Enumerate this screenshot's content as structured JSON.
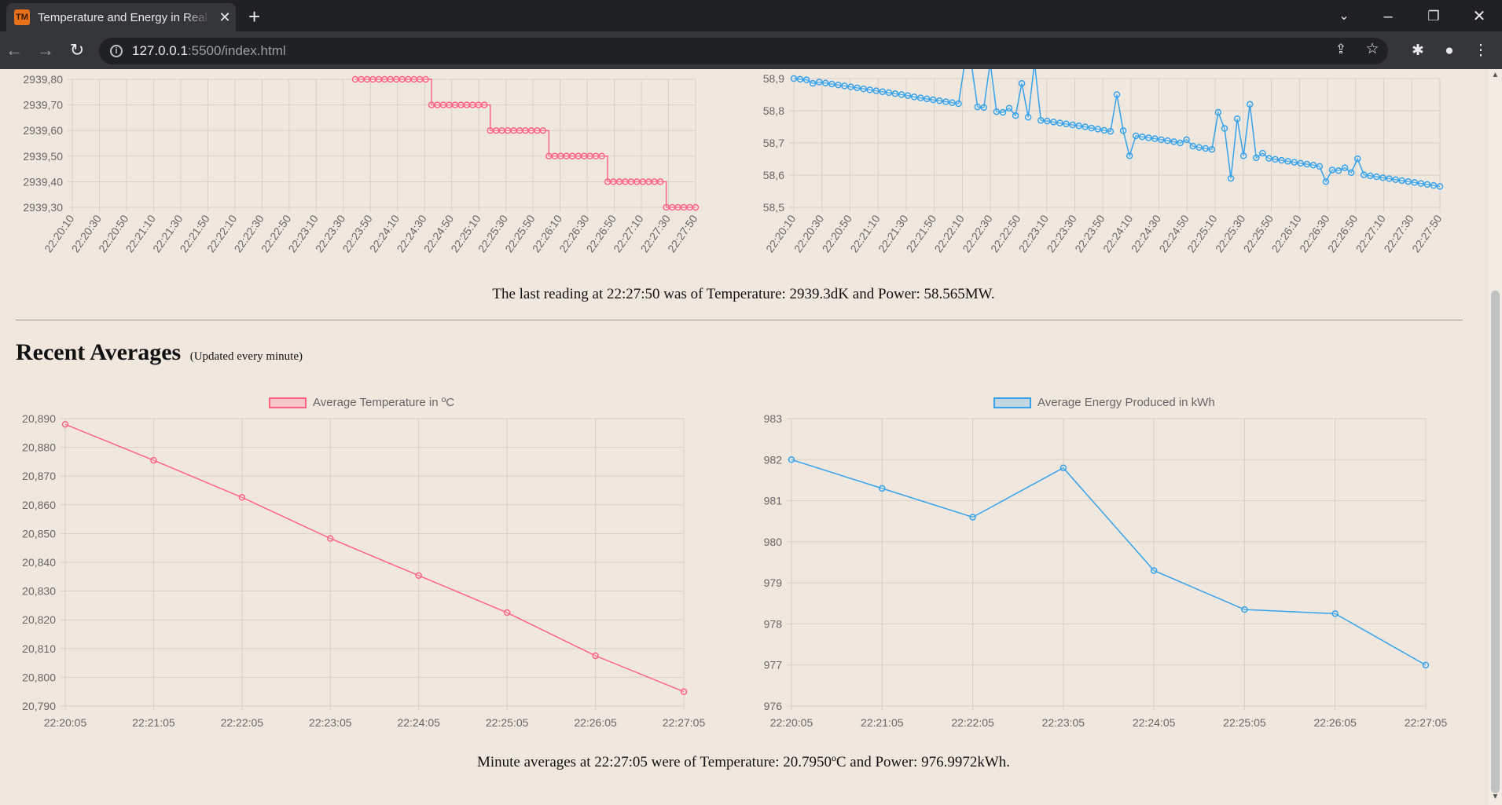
{
  "browser": {
    "tab_title": "Temperature and Energy in Real Time",
    "favicon_text": "TM",
    "url_host": "127.0.0.1",
    "url_rest": ":5500/index.html"
  },
  "live": {
    "caption": "The last reading at 22:27:50 was of Temperature: 2939.3dK and Power: 58.565MW."
  },
  "averages": {
    "heading": "Recent Averages",
    "subheading": "(Updated every minute)",
    "caption": "Minute averages at 22:27:05 were of Temperature: 20.7950ºC and Power: 976.9972kWh."
  },
  "colors": {
    "temperature": "#ff6384",
    "temperature_fill": "rgba(255,99,132,0.25)",
    "energy": "#36a2eb",
    "energy_fill": "rgba(54,162,235,0.25)"
  },
  "chart_data": [
    {
      "id": "live-temperature",
      "type": "line",
      "step": true,
      "color": "#ff6384",
      "x_ticks": [
        "22:20:10",
        "22:20:30",
        "22:20:50",
        "22:21:10",
        "22:21:30",
        "22:21:50",
        "22:22:10",
        "22:22:30",
        "22:22:50",
        "22:23:10",
        "22:23:30",
        "22:23:50",
        "22:24:10",
        "22:24:30",
        "22:24:50",
        "22:25:10",
        "22:25:30",
        "22:25:50",
        "22:26:10",
        "22:26:30",
        "22:26:50",
        "22:27:10",
        "22:27:30",
        "22:27:50"
      ],
      "y_ticks": [
        "2939,80",
        "2939,70",
        "2939,60",
        "2939,50",
        "2939,40",
        "2939,30"
      ],
      "ylim": [
        2939.3,
        2939.8
      ],
      "series": [
        {
          "values": [
            2939.8,
            2939.8,
            2939.8,
            2939.8,
            2939.8,
            2939.8,
            2939.8,
            2939.8,
            2939.8,
            2939.8,
            2939.8,
            2939.8,
            2939.8,
            2939.7,
            2939.7,
            2939.7,
            2939.7,
            2939.7,
            2939.7,
            2939.7,
            2939.7,
            2939.7,
            2939.7,
            2939.6,
            2939.6,
            2939.6,
            2939.6,
            2939.6,
            2939.6,
            2939.6,
            2939.6,
            2939.6,
            2939.6,
            2939.5,
            2939.5,
            2939.5,
            2939.5,
            2939.5,
            2939.5,
            2939.5,
            2939.5,
            2939.5,
            2939.5,
            2939.4,
            2939.4,
            2939.4,
            2939.4,
            2939.4,
            2939.4,
            2939.4,
            2939.4,
            2939.4,
            2939.4,
            2939.3,
            2939.3,
            2939.3,
            2939.3,
            2939.3,
            2939.3
          ],
          "first_tick_offset": 11
        }
      ]
    },
    {
      "id": "live-power",
      "type": "line",
      "color": "#36a2eb",
      "x_ticks": [
        "22:20:10",
        "22:20:30",
        "22:20:50",
        "22:21:10",
        "22:21:30",
        "22:21:50",
        "22:22:10",
        "22:22:30",
        "22:22:50",
        "22:23:10",
        "22:23:30",
        "22:23:50",
        "22:24:10",
        "22:24:30",
        "22:24:50",
        "22:25:10",
        "22:25:30",
        "22:25:50",
        "22:26:10",
        "22:26:30",
        "22:26:50",
        "22:27:10",
        "22:27:30",
        "22:27:50"
      ],
      "y_ticks": [
        "58,9",
        "58,8",
        "58,7",
        "58,6",
        "58,5"
      ],
      "ylim": [
        58.5,
        58.9
      ],
      "series": [
        {
          "values": [
            58.9,
            58.898,
            58.896,
            58.885,
            58.889,
            58.886,
            58.883,
            58.88,
            58.877,
            58.874,
            58.871,
            58.868,
            58.865,
            58.862,
            58.859,
            58.856,
            58.853,
            58.85,
            58.847,
            58.843,
            58.84,
            58.837,
            58.834,
            58.831,
            58.828,
            58.825,
            58.822,
            58.95,
            58.95,
            58.812,
            58.81,
            58.95,
            58.797,
            58.795,
            58.808,
            58.785,
            58.885,
            58.78,
            58.95,
            58.77,
            58.768,
            58.765,
            58.762,
            58.759,
            58.756,
            58.753,
            58.75,
            58.746,
            58.743,
            58.739,
            58.736,
            58.85,
            58.738,
            58.66,
            58.722,
            58.719,
            58.716,
            58.713,
            58.71,
            58.707,
            58.704,
            58.7,
            58.71,
            58.69,
            58.686,
            58.683,
            58.68,
            58.795,
            58.745,
            58.59,
            58.775,
            58.66,
            58.82,
            58.654,
            58.668,
            58.652,
            58.649,
            58.646,
            58.643,
            58.64,
            58.637,
            58.634,
            58.631,
            58.627,
            58.58,
            58.616,
            58.614,
            58.623,
            58.608,
            58.651,
            58.601,
            58.598,
            58.595,
            58.592,
            58.589,
            58.586,
            58.583,
            58.58,
            58.577,
            58.574,
            58.571,
            58.568,
            58.565
          ]
        }
      ]
    },
    {
      "id": "avg-temperature",
      "type": "line",
      "color": "#ff6384",
      "legend": "Average Temperature in ºC",
      "categories": [
        "22:20:05",
        "22:21:05",
        "22:22:05",
        "22:23:05",
        "22:24:05",
        "22:25:05",
        "22:26:05",
        "22:27:05"
      ],
      "y_ticks": [
        "20,890",
        "20,880",
        "20,870",
        "20,860",
        "20,850",
        "20,840",
        "20,830",
        "20,820",
        "20,810",
        "20,800",
        "20,790"
      ],
      "ylim": [
        20.79,
        20.89
      ],
      "series": [
        {
          "name": "Average Temperature in ºC",
          "values": [
            20.888,
            20.8755,
            20.8626,
            20.8483,
            20.8354,
            20.8225,
            20.8075,
            20.795
          ]
        }
      ]
    },
    {
      "id": "avg-energy",
      "type": "line",
      "color": "#36a2eb",
      "legend": "Average Energy Produced in kWh",
      "categories": [
        "22:20:05",
        "22:21:05",
        "22:22:05",
        "22:23:05",
        "22:24:05",
        "22:25:05",
        "22:26:05",
        "22:27:05"
      ],
      "y_ticks": [
        "983",
        "982",
        "981",
        "980",
        "979",
        "978",
        "977",
        "976"
      ],
      "ylim": [
        976,
        983
      ],
      "series": [
        {
          "name": "Average Energy Produced in kWh",
          "values": [
            982.0,
            981.3,
            980.6,
            981.8,
            979.3,
            978.35,
            978.25,
            976.9972
          ]
        }
      ]
    }
  ]
}
